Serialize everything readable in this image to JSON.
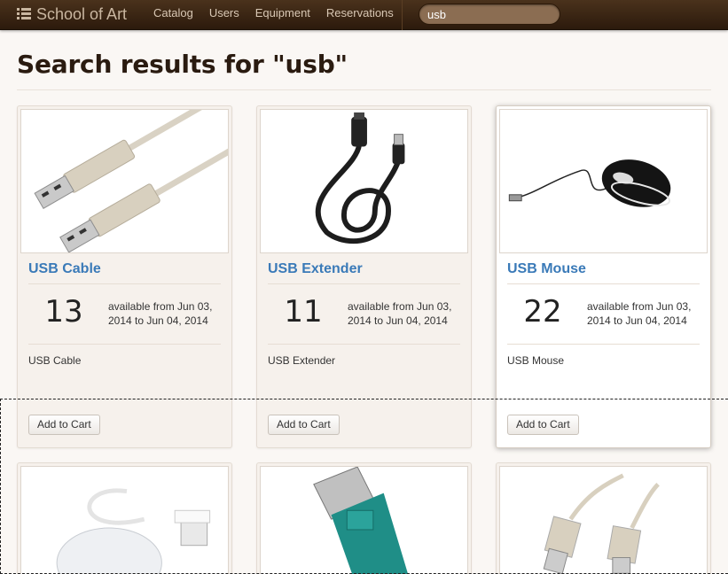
{
  "navbar": {
    "brand": "School of Art",
    "links": [
      "Catalog",
      "Users",
      "Equipment",
      "Reservations"
    ],
    "search_value": "usb"
  },
  "page": {
    "title": "Search results for \"usb\""
  },
  "results": [
    {
      "name": "USB Cable",
      "count": "13",
      "availability": "available from Jun 03, 2014 to Jun 04, 2014",
      "description": "USB Cable",
      "button": "Add to Cart",
      "image": "usb-cable-image"
    },
    {
      "name": "USB Extender",
      "count": "11",
      "availability": "available from Jun 03, 2014 to Jun 04, 2014",
      "description": "USB Extender",
      "button": "Add to Cart",
      "image": "usb-extender-image"
    },
    {
      "name": "USB Mouse",
      "count": "22",
      "availability": "available from Jun 03, 2014 to Jun 04, 2014",
      "description": "USB Mouse",
      "button": "Add to Cart",
      "image": "usb-mouse-image"
    },
    {
      "image": "imic-usb-adapter-image"
    },
    {
      "image": "green-usb-connector-image"
    },
    {
      "image": "usb-a-to-b-cable-image"
    }
  ],
  "colors": {
    "navbar": "#3a2412",
    "link": "#3a7ab8",
    "page_bg": "#faf7f4"
  }
}
